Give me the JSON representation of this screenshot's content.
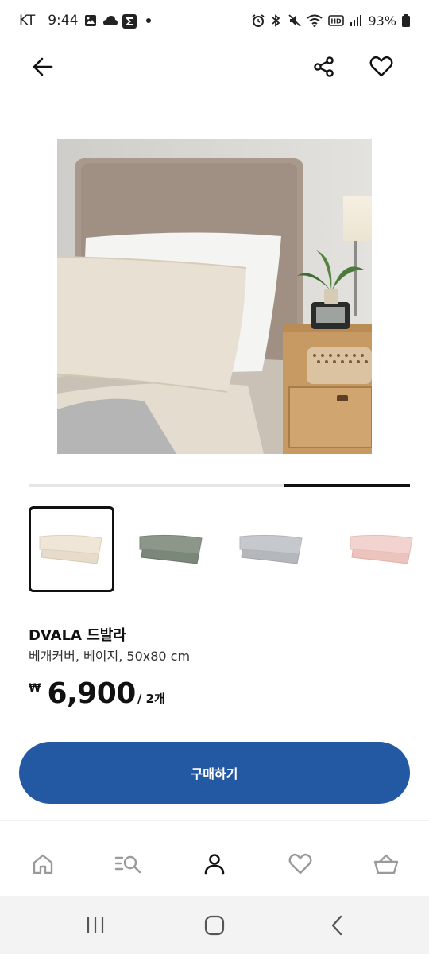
{
  "status_bar": {
    "carrier": "KT",
    "time": "9:44",
    "battery": "93%"
  },
  "header": {
    "back_icon": "arrow-left-icon",
    "share_icon": "share-icon",
    "favorite_icon": "heart-outline-icon"
  },
  "gallery": {
    "image_count": 4,
    "current_image": 4,
    "progress_fraction": 0.33
  },
  "colors": {
    "accent": "#2358a3",
    "thumb_beige": "#efe6d8",
    "thumb_green": "#8c978a",
    "thumb_grey": "#c5c8cc",
    "thumb_pink": "#f3d3cf"
  },
  "product": {
    "name": "DVALA 드발라",
    "description": "베개커버, 베이지, 50x80 cm",
    "currency": "₩",
    "price": "6,900",
    "unit": "/ 2개"
  },
  "actions": {
    "buy_label": "구매하기"
  },
  "bottom_nav": {
    "items": [
      "home-icon",
      "search-list-icon",
      "profile-icon",
      "wishlist-heart-icon",
      "basket-icon"
    ],
    "active": "profile-icon"
  },
  "system_nav": {
    "items": [
      "recent-apps-icon",
      "home-button-icon",
      "back-chevron-icon"
    ]
  }
}
